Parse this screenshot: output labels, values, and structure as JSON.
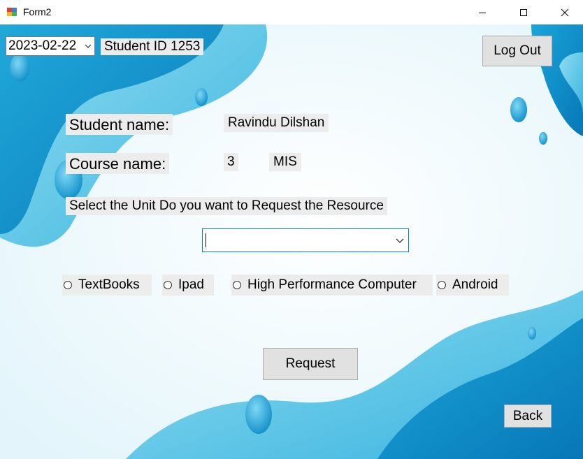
{
  "window": {
    "title": "Form2"
  },
  "header": {
    "date_value": "2023-02-22",
    "student_id": "Student ID 1253",
    "logout_label": "Log Out"
  },
  "form": {
    "student_name_label": "Student name:",
    "student_name_value": "Ravindu Dilshan",
    "course_name_label": "Course name:",
    "course_id_value": "3",
    "course_name_value": "MIS",
    "unit_prompt": "Select the Unit Do you want to Request the Resource",
    "unit_value": "",
    "resources": [
      "TextBooks",
      "Ipad",
      "High Performance Computer",
      "Android"
    ],
    "request_label": "Request",
    "back_label": "Back"
  },
  "colors": {
    "accent": "#0078d7",
    "wave_dark": "#0a8fc9",
    "wave_light": "#5cc6e6"
  }
}
